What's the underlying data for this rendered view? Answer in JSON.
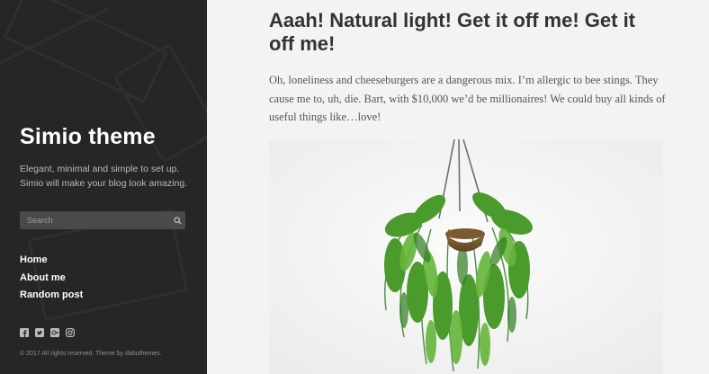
{
  "sidebar": {
    "site_title": "Simio theme",
    "site_description": "Elegant, minimal and simple to set up. Simio will make your blog look amazing.",
    "search": {
      "placeholder": "Search"
    },
    "nav": [
      {
        "label": "Home"
      },
      {
        "label": "About me"
      },
      {
        "label": "Random post"
      }
    ],
    "social_icons": [
      "facebook-icon",
      "twitter-icon",
      "google-plus-icon",
      "instagram-icon"
    ],
    "footer": "© 2017 All rights reserved. Theme by dabuthemes."
  },
  "post": {
    "title": "Aaah! Natural light! Get it off me! Get it off me!",
    "excerpt": "Oh, loneliness and cheeseburgers are a dangerous mix. I’m allergic to bee stings. They cause me to, uh, die. Bart, with $10,000 we’d be millionaires! We could buy all kinds of useful things like…love!",
    "image": "hanging-plant"
  },
  "colors": {
    "sidebar_bg": "#2a2a2a",
    "main_bg": "#f3f3f3",
    "title_text": "#333333",
    "body_text": "#555555",
    "plant_green": "#3f8f2a"
  }
}
